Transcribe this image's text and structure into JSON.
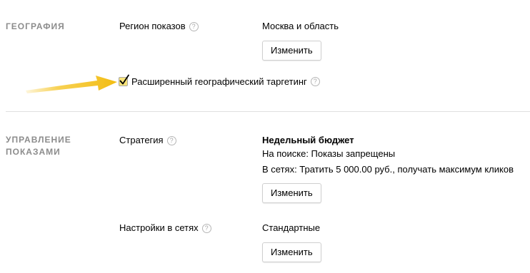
{
  "geography": {
    "section_title": "ГЕОГРАФИЯ",
    "region_label": "Регион показов",
    "region_value": "Москва и область",
    "change_button": "Изменить",
    "extended_targeting_label": "Расширенный географический таргетинг",
    "extended_targeting_checked": true
  },
  "display_management": {
    "section_title_line1": "УПРАВЛЕНИЕ",
    "section_title_line2": "ПОКАЗАМИ",
    "strategy_label": "Стратегия",
    "strategy_title": "Недельный бюджет",
    "strategy_search": "На поиске: Показы запрещены",
    "strategy_networks": "В сетях: Тратить 5 000.00 руб., получать максимум кликов",
    "strategy_change_button": "Изменить",
    "network_settings_label": "Настройки в сетях",
    "network_settings_value": "Стандартные",
    "network_change_button": "Изменить"
  },
  "help_glyph": "?",
  "icons": {
    "help": "question-circle-icon",
    "annotation": "yellow-arrow-icon"
  },
  "colors": {
    "section_title": "#8c8c8c",
    "annotation_arrow": "#f5c21b",
    "checkbox_fill": "#f7e37a"
  }
}
